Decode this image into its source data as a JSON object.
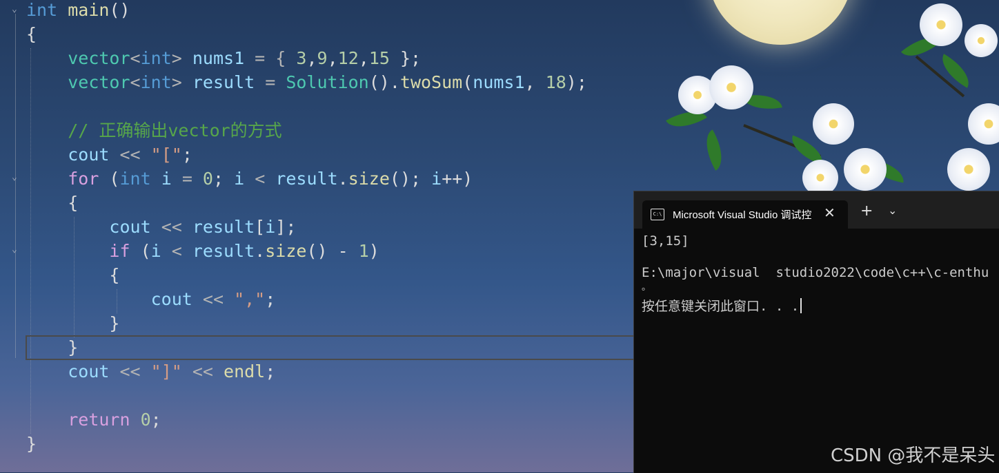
{
  "editor": {
    "lines": [
      [
        {
          "t": "int",
          "c": "kw"
        },
        {
          "t": " ",
          "c": ""
        },
        {
          "t": "main",
          "c": "fn"
        },
        {
          "t": "()",
          "c": ""
        }
      ],
      [
        {
          "t": "{",
          "c": ""
        }
      ],
      [
        {
          "t": "    ",
          "c": ""
        },
        {
          "t": "vector",
          "c": "ty"
        },
        {
          "t": "<",
          "c": "op"
        },
        {
          "t": "int",
          "c": "kw"
        },
        {
          "t": "> ",
          "c": "op"
        },
        {
          "t": "nums1",
          "c": "var"
        },
        {
          "t": " = { ",
          "c": "op"
        },
        {
          "t": "3",
          "c": "num"
        },
        {
          "t": ",",
          "c": ""
        },
        {
          "t": "9",
          "c": "num"
        },
        {
          "t": ",",
          "c": ""
        },
        {
          "t": "12",
          "c": "num"
        },
        {
          "t": ",",
          "c": ""
        },
        {
          "t": "15",
          "c": "num"
        },
        {
          "t": " };",
          "c": ""
        }
      ],
      [
        {
          "t": "    ",
          "c": ""
        },
        {
          "t": "vector",
          "c": "ty"
        },
        {
          "t": "<",
          "c": "op"
        },
        {
          "t": "int",
          "c": "kw"
        },
        {
          "t": "> ",
          "c": "op"
        },
        {
          "t": "result",
          "c": "var"
        },
        {
          "t": " = ",
          "c": "op"
        },
        {
          "t": "Solution",
          "c": "ty"
        },
        {
          "t": "().",
          "c": ""
        },
        {
          "t": "twoSum",
          "c": "fn"
        },
        {
          "t": "(",
          "c": ""
        },
        {
          "t": "nums1",
          "c": "var"
        },
        {
          "t": ", ",
          "c": ""
        },
        {
          "t": "18",
          "c": "num"
        },
        {
          "t": ");",
          "c": ""
        }
      ],
      [],
      [
        {
          "t": "    ",
          "c": ""
        },
        {
          "t": "// 正确输出vector的方式",
          "c": "cmt"
        }
      ],
      [
        {
          "t": "    ",
          "c": ""
        },
        {
          "t": "cout",
          "c": "var"
        },
        {
          "t": " << ",
          "c": "op"
        },
        {
          "t": "\"[\"",
          "c": "str"
        },
        {
          "t": ";",
          "c": ""
        }
      ],
      [
        {
          "t": "    ",
          "c": ""
        },
        {
          "t": "for",
          "c": "ctl"
        },
        {
          "t": " (",
          "c": ""
        },
        {
          "t": "int",
          "c": "kw"
        },
        {
          "t": " ",
          "c": ""
        },
        {
          "t": "i",
          "c": "var"
        },
        {
          "t": " = ",
          "c": "op"
        },
        {
          "t": "0",
          "c": "num"
        },
        {
          "t": "; ",
          "c": ""
        },
        {
          "t": "i",
          "c": "var"
        },
        {
          "t": " < ",
          "c": "op"
        },
        {
          "t": "result",
          "c": "var"
        },
        {
          "t": ".",
          "c": ""
        },
        {
          "t": "size",
          "c": "fn"
        },
        {
          "t": "(); ",
          "c": ""
        },
        {
          "t": "i",
          "c": "var"
        },
        {
          "t": "++)",
          "c": ""
        }
      ],
      [
        {
          "t": "    {",
          "c": ""
        }
      ],
      [
        {
          "t": "        ",
          "c": ""
        },
        {
          "t": "cout",
          "c": "var"
        },
        {
          "t": " << ",
          "c": "op"
        },
        {
          "t": "result",
          "c": "var"
        },
        {
          "t": "[",
          "c": ""
        },
        {
          "t": "i",
          "c": "var"
        },
        {
          "t": "];",
          "c": ""
        }
      ],
      [
        {
          "t": "        ",
          "c": ""
        },
        {
          "t": "if",
          "c": "ctl"
        },
        {
          "t": " (",
          "c": ""
        },
        {
          "t": "i",
          "c": "var"
        },
        {
          "t": " < ",
          "c": "op"
        },
        {
          "t": "result",
          "c": "var"
        },
        {
          "t": ".",
          "c": ""
        },
        {
          "t": "size",
          "c": "fn"
        },
        {
          "t": "() - ",
          "c": ""
        },
        {
          "t": "1",
          "c": "num"
        },
        {
          "t": ")",
          "c": ""
        }
      ],
      [
        {
          "t": "        {",
          "c": ""
        }
      ],
      [
        {
          "t": "            ",
          "c": ""
        },
        {
          "t": "cout",
          "c": "var"
        },
        {
          "t": " << ",
          "c": "op"
        },
        {
          "t": "\",\"",
          "c": "str"
        },
        {
          "t": ";",
          "c": ""
        }
      ],
      [
        {
          "t": "        }",
          "c": ""
        }
      ],
      [
        {
          "t": "    }",
          "c": ""
        }
      ],
      [
        {
          "t": "    ",
          "c": ""
        },
        {
          "t": "cout",
          "c": "var"
        },
        {
          "t": " << ",
          "c": "op"
        },
        {
          "t": "\"]\"",
          "c": "str"
        },
        {
          "t": " << ",
          "c": "op"
        },
        {
          "t": "endl",
          "c": "fn"
        },
        {
          "t": ";",
          "c": ""
        }
      ],
      [],
      [
        {
          "t": "    ",
          "c": ""
        },
        {
          "t": "return",
          "c": "ctl"
        },
        {
          "t": " ",
          "c": ""
        },
        {
          "t": "0",
          "c": "num"
        },
        {
          "t": ";",
          "c": ""
        }
      ],
      [
        {
          "t": "}",
          "c": ""
        }
      ]
    ]
  },
  "terminal": {
    "icon_label": "C:\\",
    "tab_title": "Microsoft Visual Studio 调试控",
    "close_glyph": "✕",
    "new_tab_glyph": "+",
    "dropdown_glyph": "⌄",
    "output_line1": "[3,15]",
    "output_line2": "E:\\major\\visual  studio2022\\code\\c++\\c-enthu",
    "output_line3": "。",
    "output_line4": "按任意键关闭此窗口. . ."
  },
  "watermark": "CSDN @我不是呆头",
  "colors": {
    "keyword": "#569cd6",
    "control": "#d8a0df",
    "type": "#4ec9b0",
    "function": "#dcdcaa",
    "variable": "#9cdcfe",
    "number": "#b5cea8",
    "string": "#d69d85",
    "comment": "#57a64a",
    "terminal_bg": "#0c0c0c"
  }
}
